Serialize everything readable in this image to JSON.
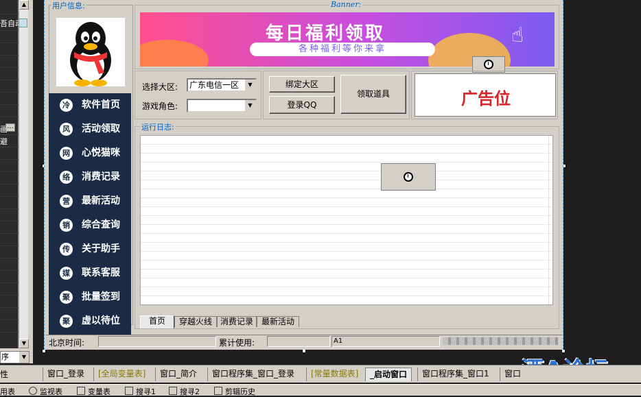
{
  "left_panel": {
    "text1": "吾自动",
    "text2": "画",
    "dots_label": "…",
    "text3": "避",
    "combo_value": "序"
  },
  "window": {
    "user_info_label": "用户信息:",
    "banner_group_label": "Banner:",
    "banner": {
      "title": "每日福利领取",
      "subtitle": "各种福利等你来拿"
    },
    "nav": [
      {
        "icon": "冷",
        "label": "软件首页"
      },
      {
        "icon": "风",
        "label": "活动领取"
      },
      {
        "icon": "网",
        "label": "心悦猫咪"
      },
      {
        "icon": "络",
        "label": "消费记录"
      },
      {
        "icon": "营",
        "label": "最新活动"
      },
      {
        "icon": "销",
        "label": "综合查询"
      },
      {
        "icon": "传",
        "label": "关于助手"
      },
      {
        "icon": "媒",
        "label": "联系客服"
      },
      {
        "icon": "聚",
        "label": "批量签到"
      },
      {
        "icon": "聚",
        "label": "虚以待位"
      }
    ],
    "select_server_label": "选择大区:",
    "select_server_value": "广东电信一区",
    "game_role_label": "游戏角色:",
    "game_role_value": "",
    "bind_button": "绑定大区",
    "login_button": "登录QQ",
    "claim_button": "领取道具",
    "ad_text": "广告位",
    "log_label": "运行日志:",
    "tabs": [
      "首页",
      "穿越火线",
      "消费记录",
      "最新活动"
    ],
    "status": {
      "beijing_time_label": "北京时间:",
      "beijing_time_value": "",
      "usage_label": "累计使用:",
      "usage_value": "",
      "cell_a1": "A1"
    }
  },
  "tabbar": {
    "left_label": "性",
    "tabs": [
      {
        "label": "窗口_登录",
        "style": "normal"
      },
      {
        "label": "[全局变量表]",
        "style": "ylw"
      },
      {
        "label": "窗口_简介",
        "style": "normal"
      },
      {
        "label": "窗口程序集_窗口_登录",
        "style": "normal"
      },
      {
        "label": "[常量数据表]",
        "style": "ylw"
      },
      {
        "label": "_启动窗口",
        "style": "active"
      },
      {
        "label": "窗口程序集_窗口1",
        "style": "normal"
      },
      {
        "label": "窗口",
        "style": "normal"
      }
    ]
  },
  "toolbar": {
    "items": [
      "用表",
      "监视表",
      "变量表",
      "搜寻1",
      "搜寻2",
      "剪辑历史"
    ]
  },
  "watermark": "酒A论坛"
}
